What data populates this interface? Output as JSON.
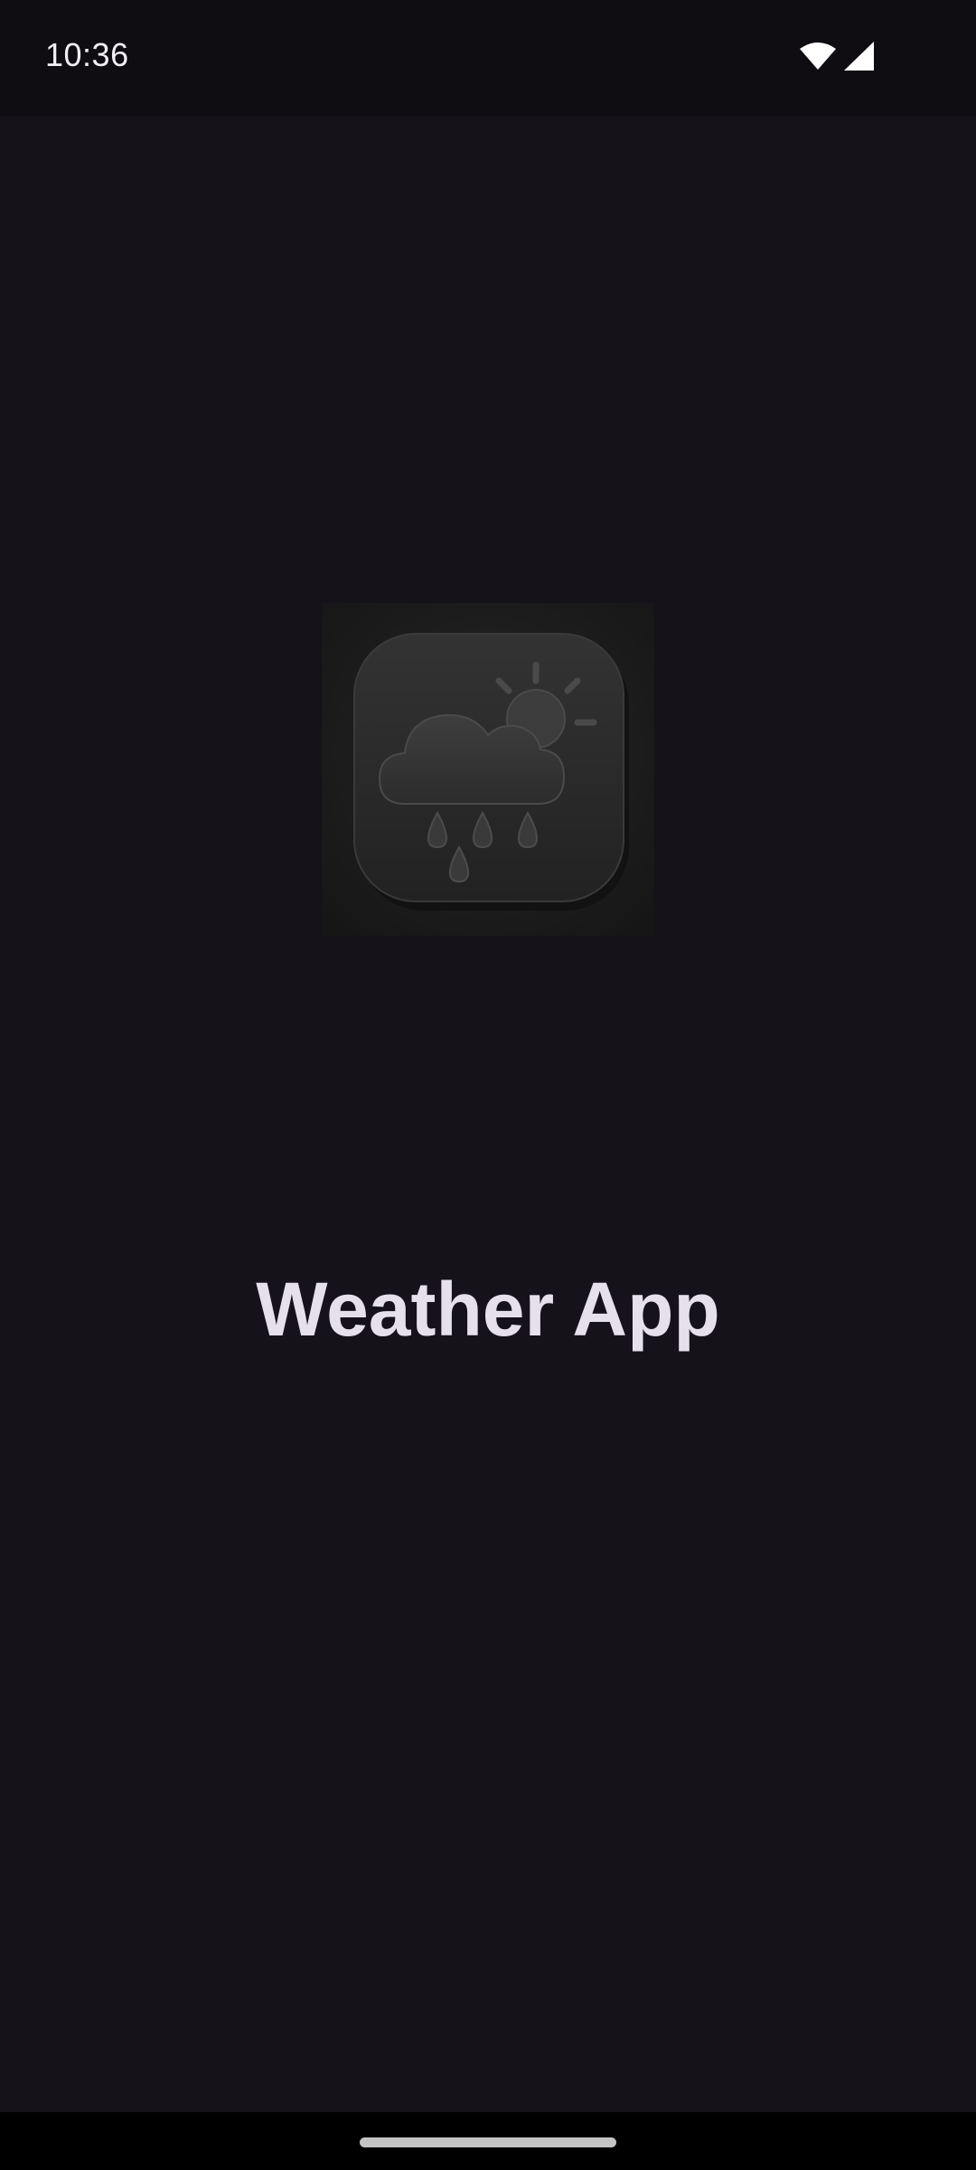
{
  "status_bar": {
    "time": "10:36",
    "icons": [
      "wifi-icon",
      "cellular-signal-icon"
    ]
  },
  "splash": {
    "logo_icon": "rain-cloud-sun-icon",
    "title": "Weather App"
  },
  "colors": {
    "background": "#151219",
    "status_bar": "#0f0d12",
    "title_text": "#e6e0ea",
    "logo_tile": "#2a2a2a"
  }
}
